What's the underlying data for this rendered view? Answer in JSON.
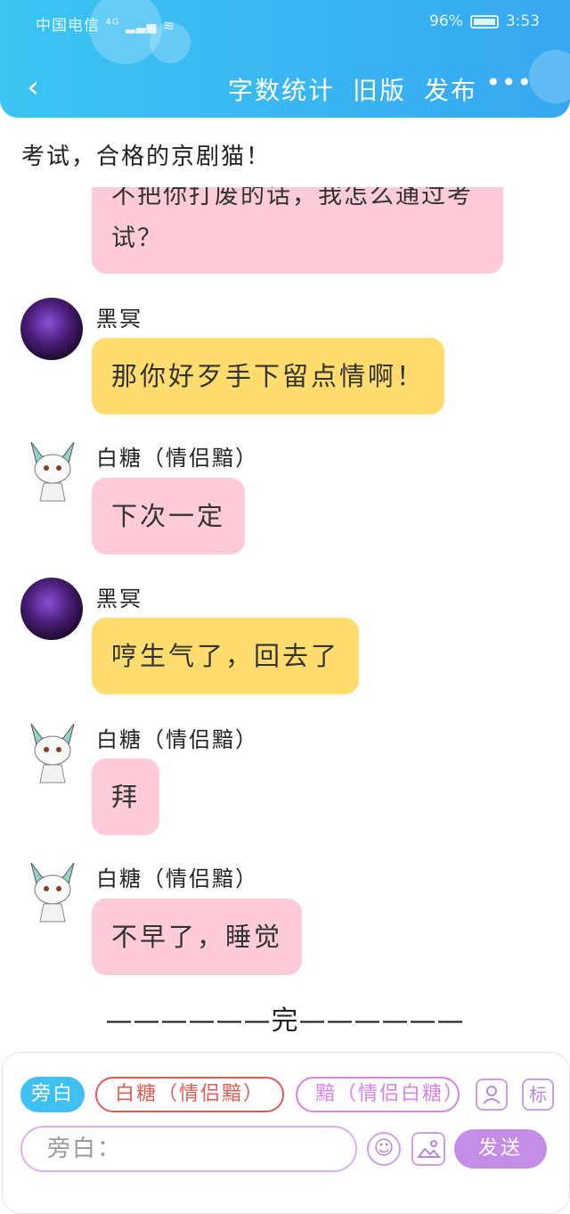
{
  "status_bar": {
    "carrier": "中国电信",
    "network": "4G",
    "battery_percent": "96%",
    "time": "3:53"
  },
  "nav": {
    "back_icon": "chevron-left-icon",
    "actions": [
      "字数统计",
      "旧版",
      "发布"
    ],
    "more_icon": "more-dots-icon"
  },
  "chat": {
    "narration_top": "考试，合格的京剧猫！",
    "cut_message": "不把你打废的话，我怎么通过考试？",
    "messages": [
      {
        "sender": "黑冥",
        "text": "那你好歹手下留点情啊！",
        "bubble_color": "#fedc6d"
      },
      {
        "sender": "白糖（情侣黯）",
        "text": "下次一定",
        "bubble_color": "#fecbd8"
      },
      {
        "sender": "黑冥",
        "text": "哼生气了，回去了",
        "bubble_color": "#fedc6d"
      },
      {
        "sender": "白糖（情侣黯）",
        "text": "拜",
        "bubble_color": "#fecbd8"
      },
      {
        "sender": "白糖（情侣黯）",
        "text": "不早了，睡觉",
        "bubble_color": "#fecbd8"
      }
    ],
    "end_marker": "——————完——————"
  },
  "composer": {
    "roles": [
      "旁白",
      "白糖（情侣黯）",
      "黯（情侣白糖）"
    ],
    "contact_icon": "person-card-icon",
    "tag_label": "标",
    "input_placeholder": "旁白：",
    "emoji_icon": "emoji-icon",
    "image_icon": "image-icon",
    "send_label": "发送"
  },
  "colors": {
    "header": "#39b4f2",
    "yellow_bubble": "#fedc6d",
    "pink_bubble": "#fecbd8",
    "accent_purple": "#c48de8"
  }
}
